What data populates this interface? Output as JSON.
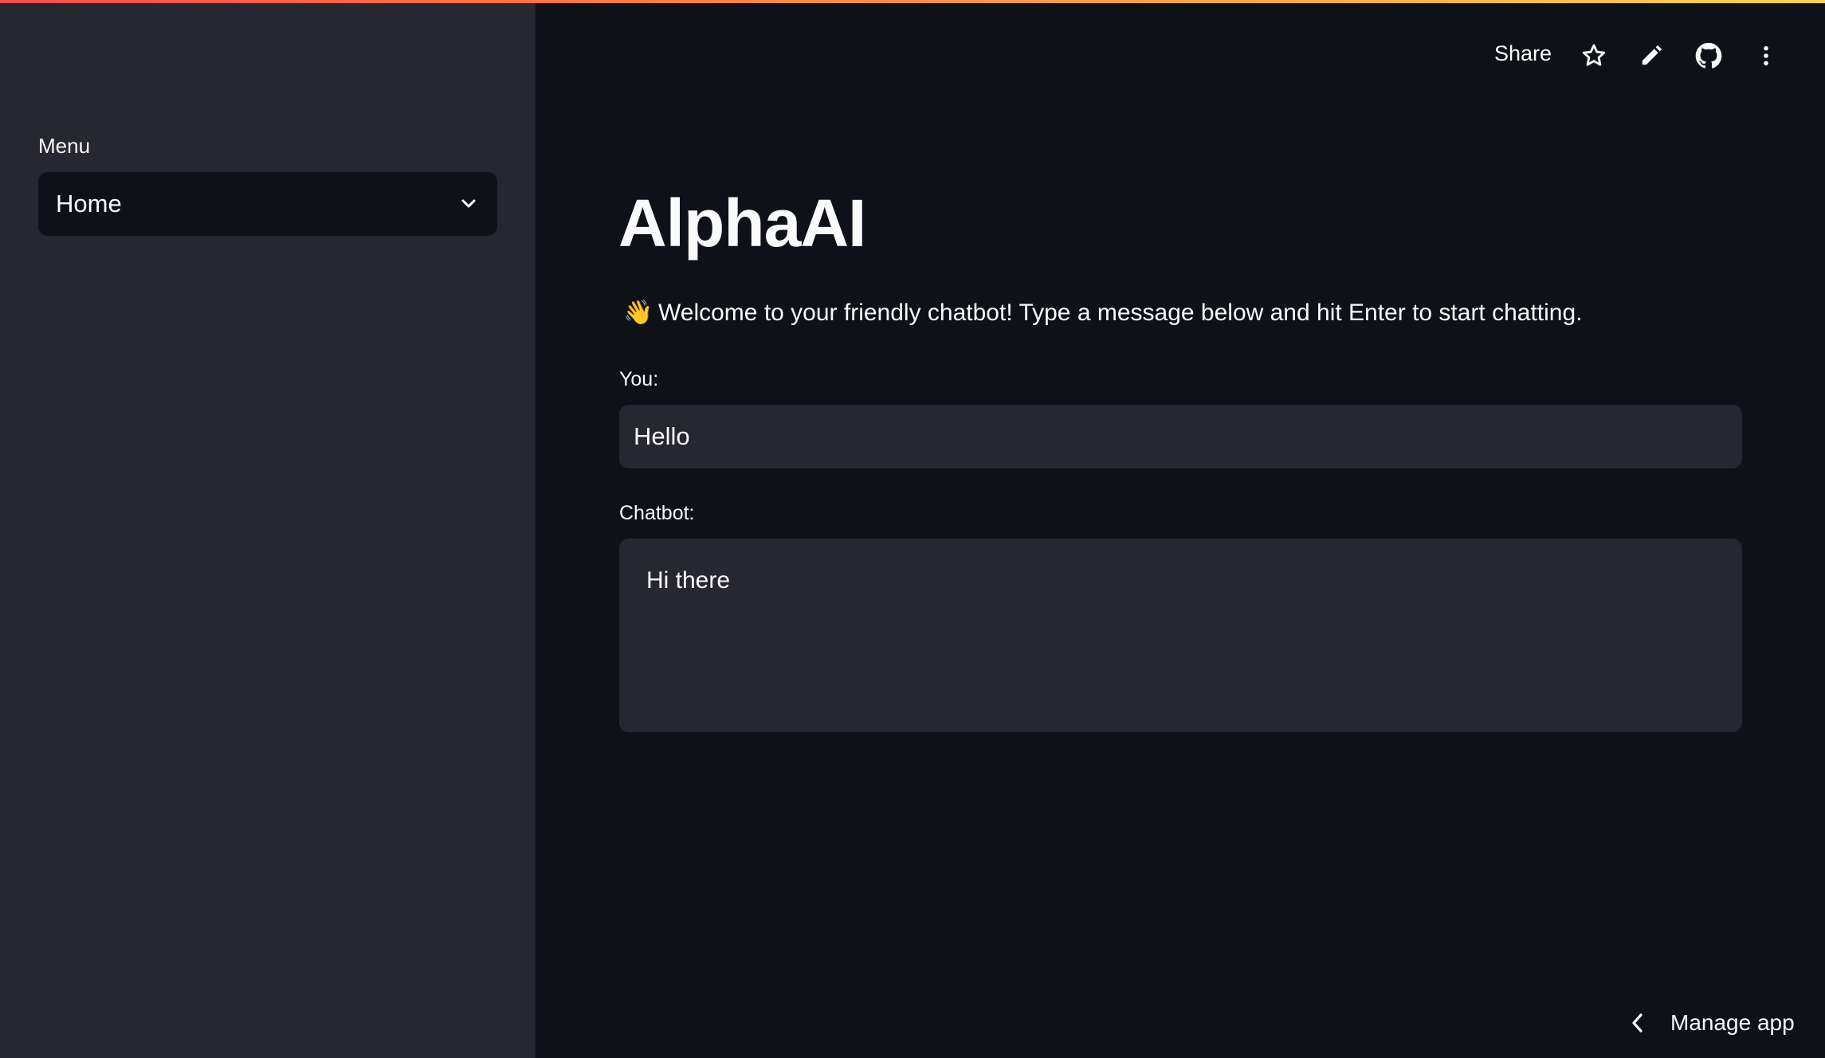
{
  "sidebar": {
    "menu_label": "Menu",
    "select_value": "Home"
  },
  "header": {
    "share_label": "Share",
    "icons": [
      "star-icon",
      "pencil-icon",
      "github-icon",
      "more-vertical-icon"
    ]
  },
  "main": {
    "title": "AlphaAI",
    "welcome_emoji": "👋",
    "welcome_text": "Welcome to your friendly chatbot! Type a message below and hit Enter to start chatting.",
    "you_label": "You:",
    "you_value": "Hello",
    "chatbot_label": "Chatbot:",
    "chatbot_value": "Hi there"
  },
  "footer": {
    "manage_label": "Manage app"
  },
  "colors": {
    "background": "#0e1117",
    "sidebar": "#262730",
    "field": "#262730",
    "text": "#fafafa",
    "accent_gradient_start": "#ff4b4b",
    "accent_gradient_end": "#ffd24a"
  }
}
